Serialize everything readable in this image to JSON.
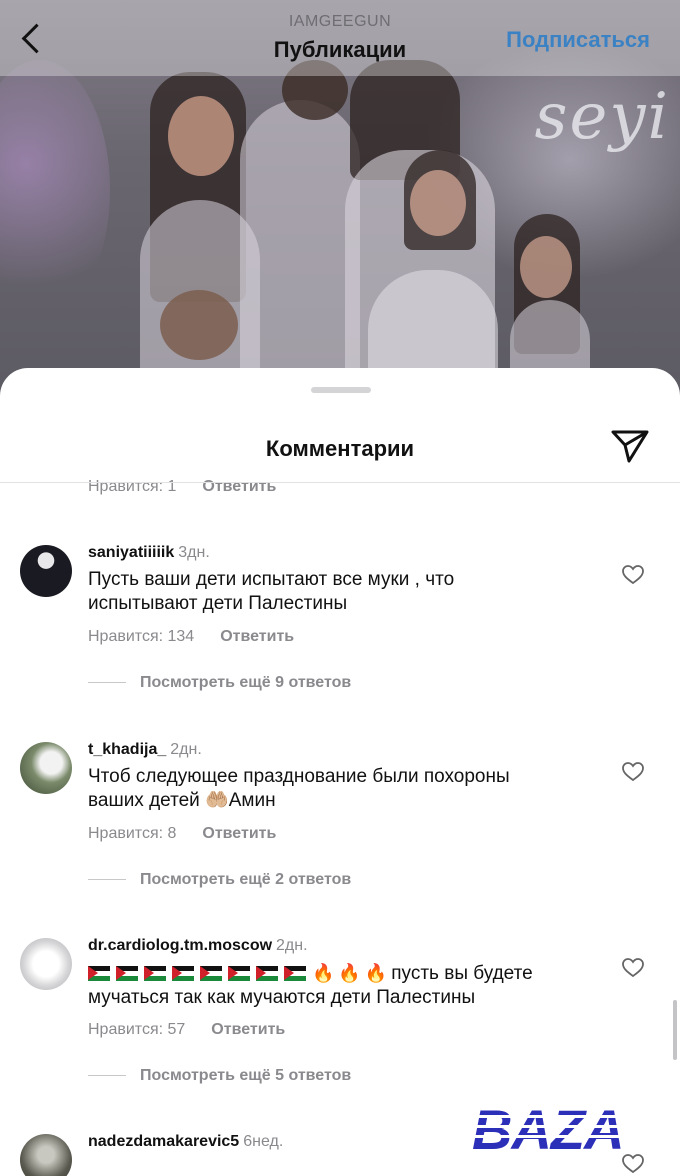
{
  "header": {
    "account": "IAMGEEGUN",
    "title": "Публикации",
    "follow_label": "Подписаться"
  },
  "photo": {
    "script_text": "seyi"
  },
  "sheet": {
    "title": "Комментарии"
  },
  "previous_comment": {
    "likes": "Нравится: 1",
    "reply": "Ответить"
  },
  "comments": [
    {
      "username": "saniyatiiiiik",
      "age": "3дн.",
      "line1": "Пусть ваши дети испытают все муки , что",
      "line2": "испытывают дети Палестины",
      "likes": "Нравится: 134",
      "reply": "Ответить",
      "view_replies": "Посмотреть ещё 9 ответов"
    },
    {
      "username": "t_khadija_",
      "age": "2дн.",
      "line1": "Чтоб следующее празднование были похороны",
      "line2_before": "ваших детей",
      "line2_emoji": "🤲🏼",
      "line2_after": "Амин",
      "likes": "Нравится: 8",
      "reply": "Ответить",
      "view_replies": "Посмотреть ещё 2 ответов"
    },
    {
      "username": "dr.cardiolog.tm.moscow",
      "age": "2дн.",
      "line1_text": "пусть вы будете",
      "line2": "мучаться так как мучаются дети Палестины",
      "likes": "Нравится: 57",
      "reply": "Ответить",
      "view_replies": "Посмотреть ещё 5 ответов"
    },
    {
      "username": "nadezdamakarevic5",
      "age": "6нед."
    }
  ],
  "icons": {
    "back": "chevron-left-icon",
    "send": "paper-plane-icon",
    "heart": "heart-outline-icon",
    "flag": "palestine-flag-emoji",
    "fire": "fire-emoji"
  },
  "colors": {
    "accent": "#3b82c4",
    "muted": "#8a8a8e",
    "watermark": "#2c2fb8"
  },
  "watermark": {
    "text": "BAZA"
  }
}
